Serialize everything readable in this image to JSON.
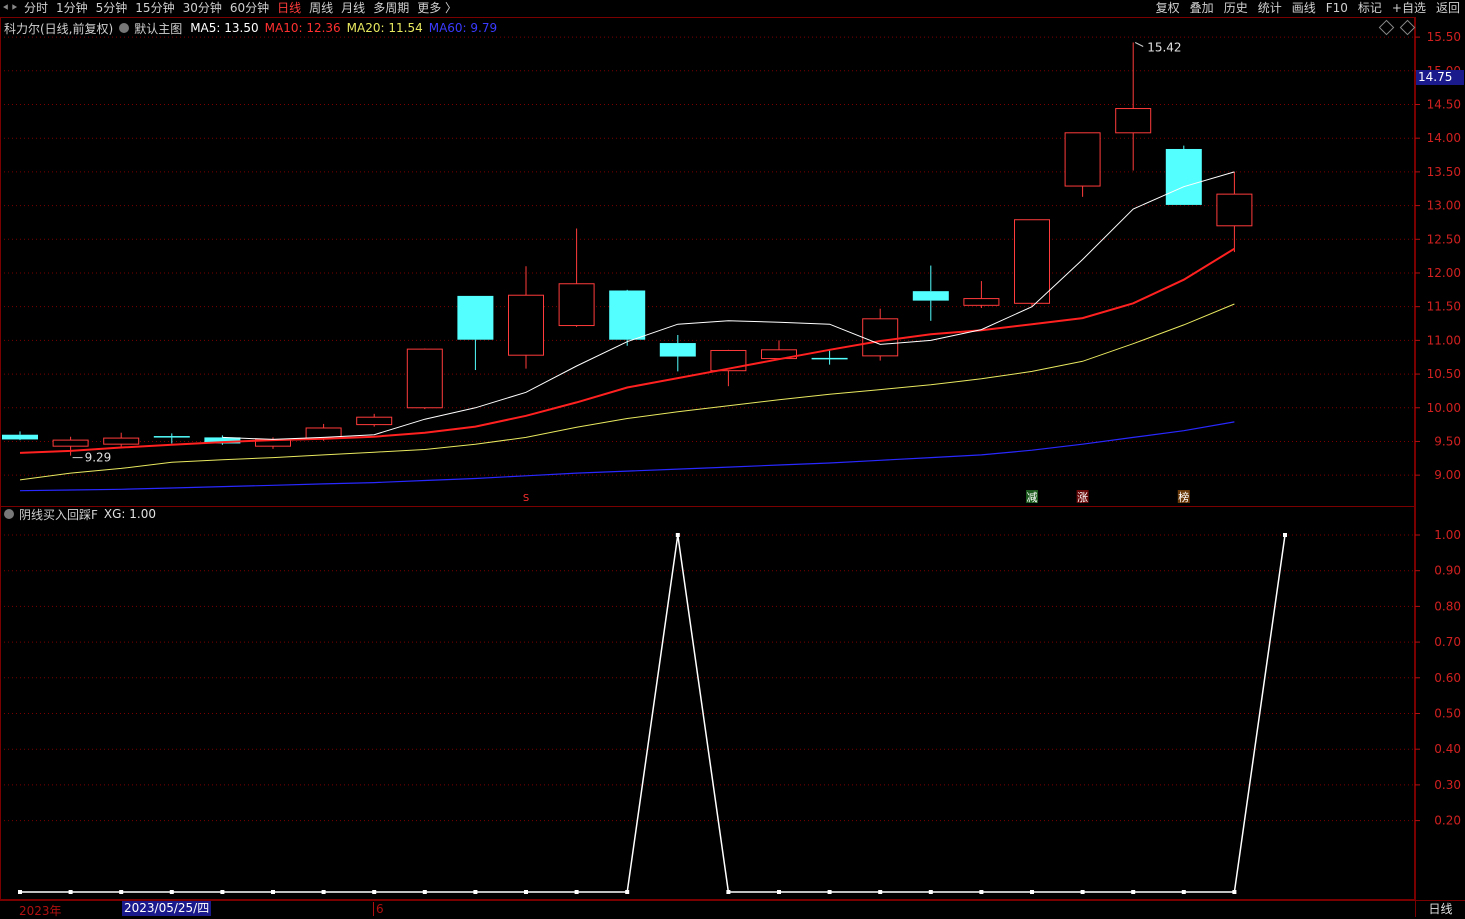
{
  "toolbar": {
    "periods": [
      {
        "label": "分时",
        "active": false
      },
      {
        "label": "1分钟",
        "active": false
      },
      {
        "label": "5分钟",
        "active": false
      },
      {
        "label": "15分钟",
        "active": false
      },
      {
        "label": "30分钟",
        "active": false
      },
      {
        "label": "60分钟",
        "active": false
      },
      {
        "label": "日线",
        "active": true
      },
      {
        "label": "周线",
        "active": false
      },
      {
        "label": "月线",
        "active": false
      },
      {
        "label": "多周期",
        "active": false
      },
      {
        "label": "更多 〉",
        "active": false
      }
    ],
    "right": [
      "复权",
      "叠加",
      "历史",
      "统计",
      "画线",
      "F10",
      "标记",
      "+自选",
      "返回"
    ]
  },
  "main_header": {
    "stock": "科力尔(日线,前复权)",
    "template": "默认主图",
    "ma5": "MA5: 13.50",
    "ma10": "MA10: 12.36",
    "ma20": "MA20: 11.54",
    "ma60": "MA60: 9.79"
  },
  "indicator_header": {
    "name": "阴线买入回踩F",
    "value": "XG: 1.00"
  },
  "current_price": "14.75",
  "high_label": "15.42",
  "low_label": "9.29",
  "signals": [
    "S",
    "减",
    "涨",
    "榜"
  ],
  "bottom": {
    "year": "2023年",
    "cursor_date": "2023/05/25/四",
    "month": "6",
    "period": "日线"
  },
  "colors": {
    "up": "#ff3b3b",
    "down": "#54ffff",
    "ma5": "#ffffff",
    "ma10": "#ff2020",
    "ma20": "#e8e860",
    "ma60": "#2828ff",
    "grid": "#7a0000"
  },
  "chart_data": [
    {
      "type": "candlestick",
      "ylim": [
        8.75,
        15.65
      ],
      "yticks": [
        "9.00",
        "9.50",
        "10.00",
        "10.50",
        "11.00",
        "11.50",
        "12.00",
        "12.50",
        "13.00",
        "13.50",
        "14.00",
        "14.50",
        "15.00",
        "15.50"
      ],
      "candles": [
        {
          "o": 9.6,
          "h": 9.65,
          "l": 9.52,
          "c": 9.53
        },
        {
          "o": 9.43,
          "h": 9.57,
          "l": 9.29,
          "c": 9.52
        },
        {
          "o": 9.46,
          "h": 9.63,
          "l": 9.4,
          "c": 9.55
        },
        {
          "o": 9.58,
          "h": 9.62,
          "l": 9.47,
          "c": 9.56
        },
        {
          "o": 9.56,
          "h": 9.59,
          "l": 9.45,
          "c": 9.47
        },
        {
          "o": 9.43,
          "h": 9.56,
          "l": 9.39,
          "c": 9.53
        },
        {
          "o": 9.55,
          "h": 9.76,
          "l": 9.51,
          "c": 9.7
        },
        {
          "o": 9.75,
          "h": 9.91,
          "l": 9.72,
          "c": 9.86
        },
        {
          "o": 10.0,
          "h": 10.88,
          "l": 9.98,
          "c": 10.87
        },
        {
          "o": 11.66,
          "h": 11.66,
          "l": 10.56,
          "c": 11.01
        },
        {
          "o": 10.78,
          "h": 12.1,
          "l": 10.58,
          "c": 11.67
        },
        {
          "o": 11.22,
          "h": 12.66,
          "l": 11.2,
          "c": 11.84
        },
        {
          "o": 11.74,
          "h": 11.75,
          "l": 10.92,
          "c": 11.01
        },
        {
          "o": 10.96,
          "h": 11.08,
          "l": 10.54,
          "c": 10.76
        },
        {
          "o": 10.55,
          "h": 10.86,
          "l": 10.32,
          "c": 10.85
        },
        {
          "o": 10.73,
          "h": 11.0,
          "l": 10.72,
          "c": 10.86
        },
        {
          "o": 10.74,
          "h": 10.86,
          "l": 10.64,
          "c": 10.72
        },
        {
          "o": 10.77,
          "h": 11.47,
          "l": 10.7,
          "c": 11.32
        },
        {
          "o": 11.73,
          "h": 12.11,
          "l": 11.29,
          "c": 11.59
        },
        {
          "o": 11.52,
          "h": 11.88,
          "l": 11.48,
          "c": 11.62
        },
        {
          "o": 11.55,
          "h": 11.61,
          "l": 11.5,
          "c": 12.79
        },
        {
          "o": 13.29,
          "h": 14.08,
          "l": 13.13,
          "c": 14.08
        },
        {
          "o": 14.08,
          "h": 15.42,
          "l": 13.52,
          "c": 14.44
        },
        {
          "o": 13.84,
          "h": 13.89,
          "l": 13.01,
          "c": 13.01
        },
        {
          "o": 12.7,
          "h": 13.5,
          "l": 12.31,
          "c": 13.17
        }
      ],
      "ma5": [
        null,
        null,
        null,
        null,
        9.56,
        9.53,
        9.56,
        9.6,
        9.83,
        10.0,
        10.23,
        10.62,
        10.98,
        11.24,
        11.29,
        11.27,
        11.24,
        10.94,
        11.0,
        11.16,
        11.5,
        12.2,
        12.95,
        13.28,
        13.5
      ],
      "ma10": [
        9.33,
        9.36,
        9.41,
        9.45,
        9.49,
        9.52,
        9.54,
        9.57,
        9.63,
        9.72,
        9.88,
        10.08,
        10.3,
        10.44,
        10.58,
        10.72,
        10.86,
        10.99,
        11.09,
        11.15,
        11.24,
        11.33,
        11.55,
        11.9,
        12.36
      ],
      "ma20": [
        8.93,
        9.03,
        9.1,
        9.19,
        9.23,
        9.26,
        9.3,
        9.34,
        9.38,
        9.46,
        9.56,
        9.71,
        9.84,
        9.94,
        10.03,
        10.12,
        10.2,
        10.27,
        10.34,
        10.43,
        10.54,
        10.69,
        10.95,
        11.23,
        11.54
      ],
      "ma60": [
        8.77,
        8.78,
        8.79,
        8.81,
        8.83,
        8.85,
        8.87,
        8.89,
        8.92,
        8.95,
        8.99,
        9.03,
        9.06,
        9.09,
        9.12,
        9.15,
        9.18,
        9.22,
        9.26,
        9.3,
        9.37,
        9.46,
        9.56,
        9.66,
        9.79
      ]
    },
    {
      "type": "line",
      "ylim": [
        0,
        1.07
      ],
      "yticks": [
        "0.20",
        "0.30",
        "0.40",
        "0.50",
        "0.60",
        "0.70",
        "0.80",
        "0.90",
        "1.00"
      ],
      "values": [
        0,
        0,
        0,
        0,
        0,
        0,
        0,
        0,
        0,
        0,
        0,
        0,
        0,
        1,
        0,
        0,
        0,
        0,
        0,
        0,
        0,
        0,
        0,
        0,
        0,
        1
      ]
    }
  ]
}
